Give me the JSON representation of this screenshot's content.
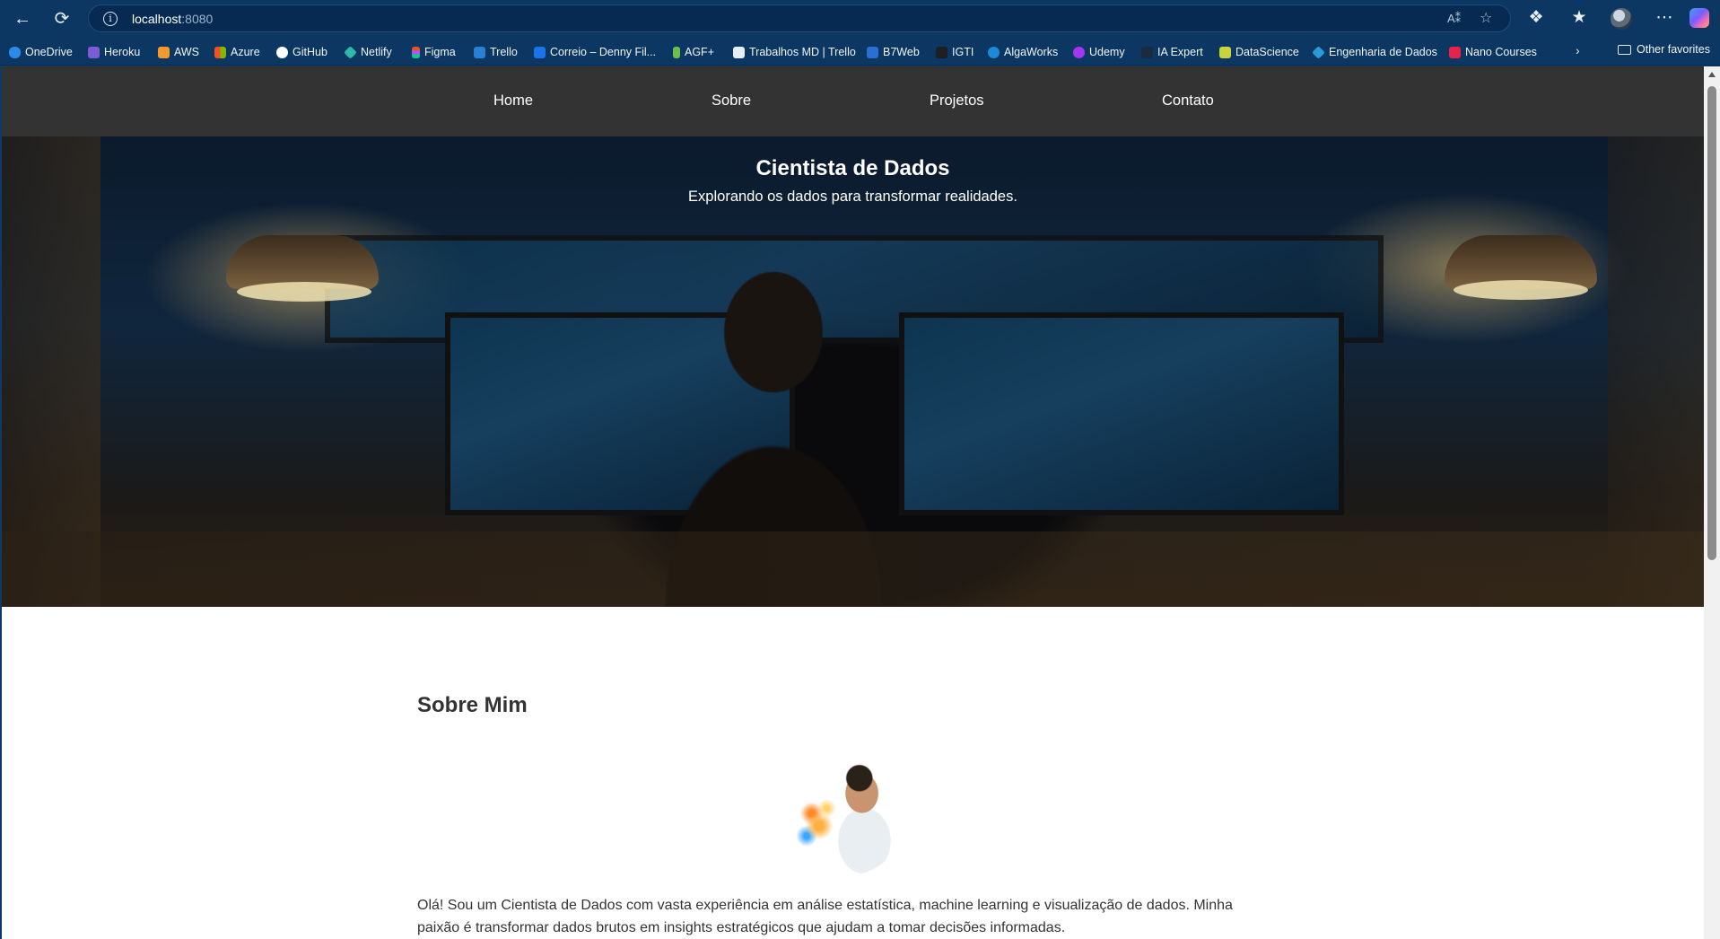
{
  "browser": {
    "url_host": "localhost",
    "url_port": ":8080",
    "bookmarks": [
      {
        "label": "OneDrive",
        "color": "#2b8be6"
      },
      {
        "label": "Heroku",
        "color": "#7b5bd6"
      },
      {
        "label": "AWS",
        "color": "#f29a2e"
      },
      {
        "label": "Azure",
        "color": "#f25022"
      },
      {
        "label": "GitHub",
        "color": "#ffffff"
      },
      {
        "label": "Netlify",
        "color": "#2fb8a8"
      },
      {
        "label": "Figma",
        "color": "#f24e1e"
      },
      {
        "label": "Trello",
        "color": "#2a7fd4"
      },
      {
        "label": "Correio – Denny Fil...",
        "color": "#1a73e8"
      },
      {
        "label": "AGF+",
        "color": "#6cc04a"
      },
      {
        "label": "Trabalhos MD | Trello",
        "color": "#e8eef5"
      },
      {
        "label": "B7Web",
        "color": "#2a6fd4"
      },
      {
        "label": "IGTI",
        "color": "#1f1f1f"
      },
      {
        "label": "AlgaWorks",
        "color": "#1c8ad8"
      },
      {
        "label": "Udemy",
        "color": "#a435f0"
      },
      {
        "label": "IA Expert",
        "color": "#1b2a3c"
      },
      {
        "label": "DataScience",
        "color": "#c9d43a"
      },
      {
        "label": "Engenharia de Dados",
        "color": "#2a9ad8"
      },
      {
        "label": "Nano Courses",
        "color": "#e8234a"
      }
    ],
    "other_favorites": "Other favorites"
  },
  "site": {
    "nav": [
      "Home",
      "Sobre",
      "Projetos",
      "Contato"
    ],
    "hero": {
      "title": "Cientista de Dados",
      "subtitle": "Explorando os dados para transformar realidades."
    },
    "about": {
      "title": "Sobre Mim",
      "text": "Olá! Sou um Cientista de Dados com vasta experiência em análise estatística, machine learning e visualização de dados. Minha paixão é transformar dados brutos em insights estratégicos que ajudam a tomar decisões informadas."
    }
  },
  "colors": {
    "chrome": "#0d3763",
    "site_nav": "#333333",
    "text": "#333333"
  }
}
